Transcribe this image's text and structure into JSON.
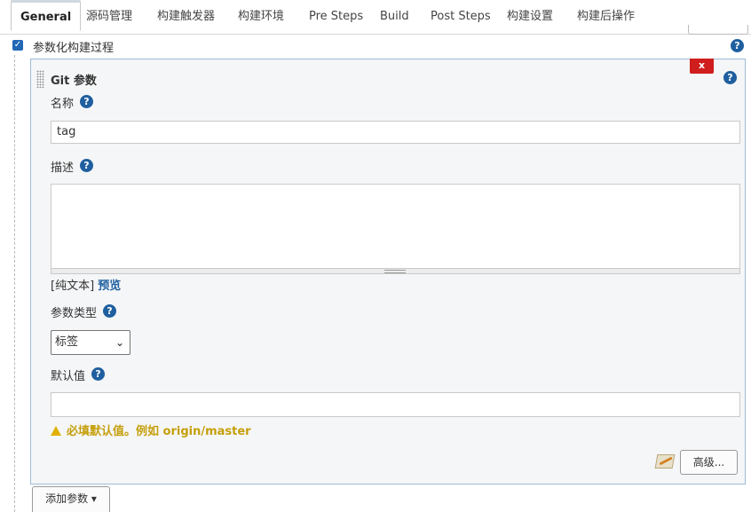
{
  "tabs": [
    {
      "label": "General",
      "active": true
    },
    {
      "label": "源码管理"
    },
    {
      "label": "构建触发器"
    },
    {
      "label": "构建环境"
    },
    {
      "label": "Pre Steps"
    },
    {
      "label": "Build"
    },
    {
      "label": "Post Steps"
    },
    {
      "label": "构建设置"
    },
    {
      "label": "构建后操作"
    }
  ],
  "param_checkbox": {
    "label": "参数化构建过程",
    "checked": true
  },
  "help_glyph": "?",
  "git_param": {
    "title": "Git 参数",
    "close_label": "x",
    "name": {
      "label": "名称",
      "value": "tag"
    },
    "description": {
      "label": "描述",
      "value": ""
    },
    "format": {
      "plain": "[纯文本]",
      "preview": "预览"
    },
    "param_type": {
      "label": "参数类型",
      "selected": "标签"
    },
    "default_value": {
      "label": "默认值",
      "value": "",
      "warning": "必填默认值。例如 origin/master"
    },
    "advanced_button": "高级..."
  },
  "add_param_button": "添加参数 ▾",
  "colors": {
    "accent": "#1f5fa0",
    "close": "#d01d1d",
    "warning": "#c59f0b",
    "panel_border": "#9dbbd6"
  }
}
